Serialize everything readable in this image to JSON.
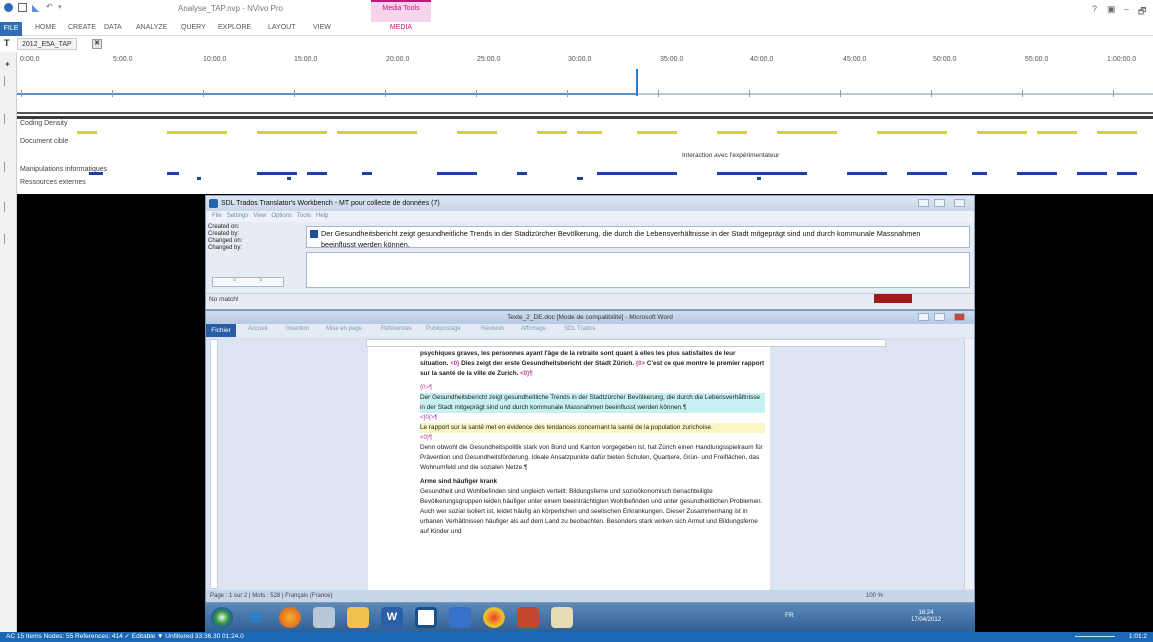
{
  "window": {
    "title": "Analyse_TAP.nvp - NVivo Pro",
    "context_tab": "Media Tools",
    "controls": [
      "?",
      "▣",
      "–",
      "🗗"
    ]
  },
  "ribbon": {
    "file": "FILE",
    "tabs": [
      "HOME",
      "CREATE",
      "DATA",
      "ANALYZE",
      "QUERY",
      "EXPLORE",
      "LAYOUT",
      "VIEW"
    ],
    "active_context": "MEDIA"
  },
  "document_tab": {
    "label": "2012_E5A_TAP",
    "close": "✖"
  },
  "timeline": {
    "labels": [
      "0:00.0",
      "5:00.0",
      "10:00.0",
      "15:00.0",
      "20:00.0",
      "25:00.0",
      "30:00.0",
      "35:00.0",
      "40:00.0",
      "45:00.0",
      "50:00.0",
      "55:00.0",
      "1:00:00.0"
    ],
    "played_fraction": 0.545
  },
  "coding_stripes": {
    "rows": [
      "Coding Density",
      "Document cible",
      "Manipulations informatiques",
      "Ressources externes"
    ],
    "annotation": "Interaction avec l'expérimentateur",
    "colors": {
      "density": "#3a3a3a",
      "target": "#d7d12a",
      "manip": "#1f3fa5",
      "resources": "#1f3fa5"
    }
  },
  "trados": {
    "title": "SDL Trados Translator's Workbench - MT pour collecte de données (7)",
    "menu": [
      "File",
      "Settings",
      "View",
      "Options",
      "Tools",
      "Help"
    ],
    "meta": [
      "Created on:",
      "Created by:",
      "Changed on:",
      "Changed by:"
    ],
    "source_text": "Der Gesundheitsbericht zeigt gesundheitliche Trends in der Stadtzürcher Bevölkerung, die durch die Lebensverhältnisse in der Stadt mitgeprägt sind und durch kommunale Massnahmen beeinflusst werden können.",
    "status": "No match!",
    "nav": [
      "<",
      ">"
    ]
  },
  "word": {
    "title": "Texte_2_DE.doc [Mode de compatibilité] - Microsoft Word",
    "tabs": [
      "Fichier",
      "Accueil",
      "Insertion",
      "Mise en page",
      "Références",
      "Publipostage",
      "Révision",
      "Affichage",
      "SDL Trados"
    ],
    "paragraphs": [
      {
        "text": "psychiques graves, les personnes ayant l'âge de la retraite sont quant à elles les plus satisfaites de leur situation.",
        "tag": "<0}",
        "bold": true
      },
      {
        "text": "Dies zeigt der erste Gesundheitsbericht der Stadt Zürich.",
        "tag": "{0>",
        "bold": true
      },
      {
        "text": "C'est ce que montre le premier rapport sur la santé de la ville de Zurich.",
        "tag": "<0}¶",
        "bold": true
      },
      {
        "text": "{0>¶",
        "kind": "tag"
      },
      {
        "text": "Der Gesundheitsbericht zeigt gesundheitliche Trends in der Stadtzürcher Bevölkerung, die durch die Lebensverhältnisse in der Stadt mitgeprägt sind und durch kommunale Massnahmen beeinflusst werden können.¶",
        "kind": "cyan"
      },
      {
        "text": "<}0{>¶",
        "kind": "tag"
      },
      {
        "text": "Le rapport sur la santé met en évidence des tendances concernant la santé de la population zurichoise.",
        "kind": "yellow"
      },
      {
        "text": "<0}¶",
        "kind": "tag"
      },
      {
        "text": "Denn obwohl die Gesundheitspolitik stark von Bund und Kanton vorgegeben ist, hat Zürich einen Handlungsspielraum für Prävention und Gesundheitsförderung. Ideale Ansatzpunkte dafür bieten Schulen, Quartiere, Grün- und Freiflächen, das Wohnumfeld und die sozialen Netze.¶",
        "kind": "plain"
      },
      {
        "text": "Arme sind häufiger krank",
        "kind": "heading"
      },
      {
        "text": "Gesundheit und Wohlbefinden sind ungleich verteilt: Bildungsferne und sozioökonomisch benachteiligte Bevölkerungsgruppen leiden häufiger unter einem beeinträchtigten Wohlbefinden und unter gesundheitlichen Problemen. Auch wer sozial isoliert ist, leidet häufig an körperlichen und seelischen Erkrankungen. Dieser Zusammenhang ist in urbanen Verhältnissen häufiger als auf dem Land zu beobachten. Besonders stark wirken sich Armut und Bildungsferne auf Kinder und",
        "kind": "plain"
      }
    ],
    "status": "Page : 1 sur 2 | Mots : 528 | Français (France)",
    "zoom": "100 %"
  },
  "taskbar": {
    "lang": "FR",
    "time": "16:24",
    "date": "17/04/2012"
  },
  "statusbar": {
    "text": "AC   15 Items   Nodes: 55  References: 414   ✓ Editable   ▼ Unfiltered   33:36.30 01:24.0",
    "right": "1:01:2"
  }
}
